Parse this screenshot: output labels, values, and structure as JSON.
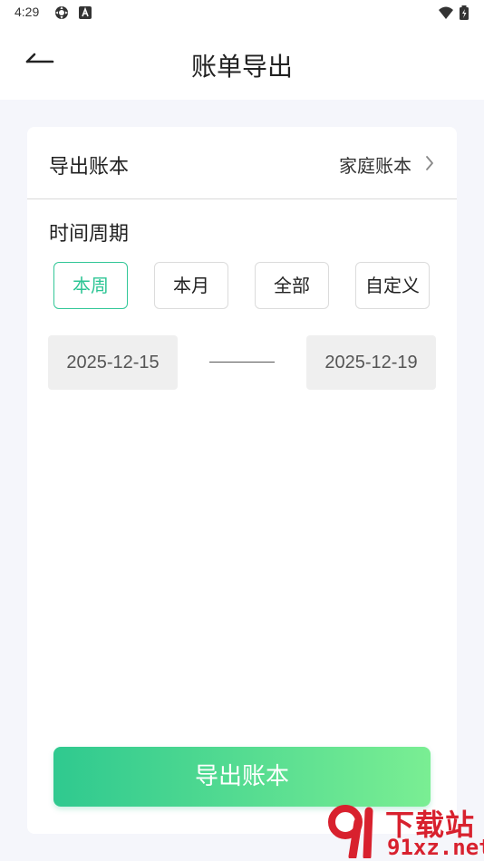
{
  "status_bar": {
    "time": "4:29",
    "left_icons": [
      "settings-gear-icon",
      "a-box-icon"
    ],
    "right_icons": [
      "wifi-icon",
      "battery-icon"
    ]
  },
  "header": {
    "back_icon": "back-arrow-icon",
    "title": "账单导出"
  },
  "export_book": {
    "label": "导出账本",
    "value": "家庭账本",
    "chevron_icon": "chevron-right-icon"
  },
  "period": {
    "title": "时间周期",
    "options": [
      "本周",
      "本月",
      "全部",
      "自定义"
    ],
    "selected": "本周",
    "start_date": "2025-12-15",
    "end_date": "2025-12-19"
  },
  "export_button": {
    "label": "导出账本"
  },
  "watermark": {
    "title": "下载站",
    "domain": "91xz.net"
  },
  "colors": {
    "accent": "#2ec595",
    "gradient_start": "#2fc98f",
    "gradient_end": "#7aee93",
    "page_bg": "#f5f6fb",
    "watermark_red": "#d8212e"
  }
}
